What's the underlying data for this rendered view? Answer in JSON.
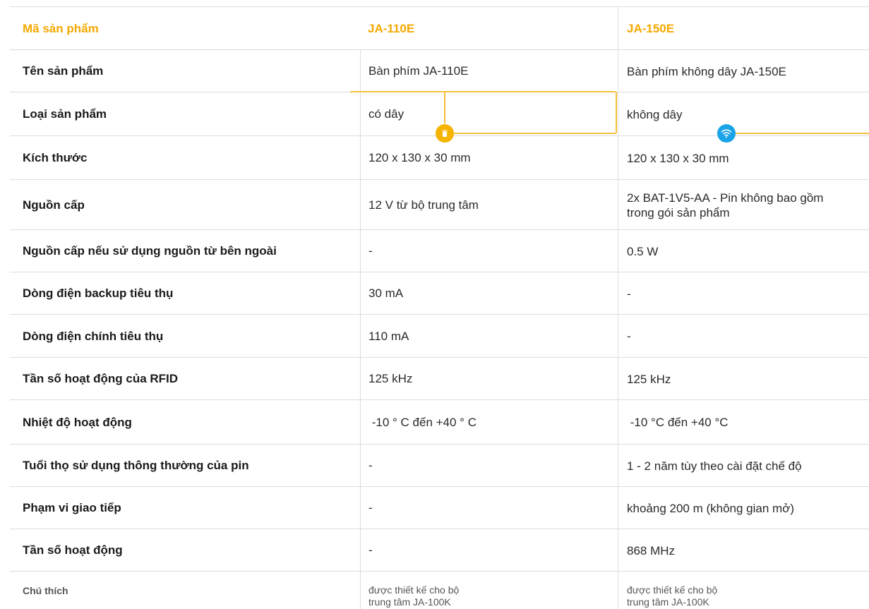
{
  "colors": {
    "accent": "#f5a800",
    "wireless_dot": "#1aa3e8"
  },
  "icons": {
    "wired": "cable-plug-icon",
    "wireless": "wifi-icon"
  },
  "header": {
    "label": "Mã sản phẩm",
    "col1": "JA-110E",
    "col2": "JA-150E"
  },
  "rows": [
    {
      "label": "Tên sản phẩm",
      "v1": "Bàn phím JA-110E",
      "v2": "Bàn phím không dây JA-150E"
    },
    {
      "label": "Loại sản phẩm",
      "v1": "có dây",
      "v2": "không dây"
    },
    {
      "label": "Kích thước",
      "v1": "120 x 130 x 30 mm",
      "v2": "120 x 130 x 30 mm"
    },
    {
      "label": "Nguồn cấp",
      "v1": "12 V từ bộ trung tâm",
      "v2": "2x BAT-1V5-AA - Pin không bao gồm trong gói sản phẩm"
    },
    {
      "label": "Nguồn cấp nếu sử dụng nguồn từ bên ngoài",
      "v1": "-",
      "v2": "0.5 W"
    },
    {
      "label": "Dòng điện backup tiêu thụ",
      "v1": "30 mA",
      "v2": "-"
    },
    {
      "label": "Dòng điện chính tiêu thụ",
      "v1": "110 mA",
      "v2": "-"
    },
    {
      "label": "Tần số hoạt động của RFID",
      "v1": "125 kHz",
      "v2": "125 kHz"
    },
    {
      "label": "Nhiệt độ hoạt động",
      "v1": " -10 ° C đến +40 ° C",
      "v2": " -10 °C đến +40 °C"
    },
    {
      "label": "Tuổi thọ sử dụng thông thường của pin",
      "v1": "-",
      "v2": "1 - 2 năm tùy theo cài đặt chế độ"
    },
    {
      "label": "Phạm vi giao tiếp",
      "v1": "-",
      "v2": "khoảng 200 m (không gian mở)"
    },
    {
      "label": "Tần số hoạt động",
      "v1": "-",
      "v2": "868 MHz"
    }
  ],
  "footer": {
    "label": "Chú thích",
    "v1": "được thiết kế cho bộ trung tâm JA-100K",
    "v2": "được thiết kế cho bộ trung tâm JA-100K"
  }
}
